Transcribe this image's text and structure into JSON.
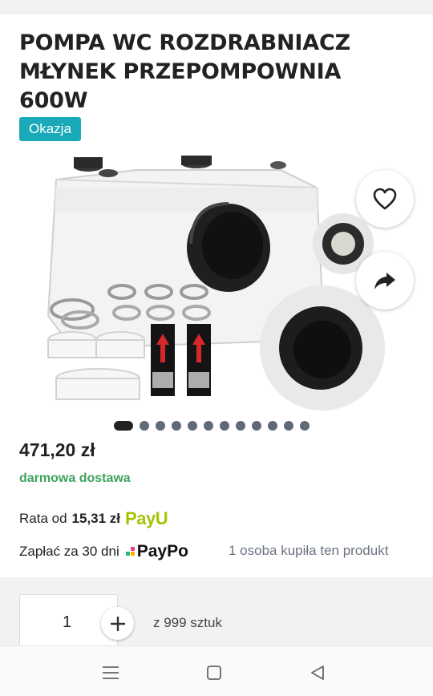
{
  "product": {
    "title_line1": "POMPA WC ROZDRABNIACZ",
    "title_line2": "MŁYNEK PRZEPOMPOWNIA",
    "title_line3": "600W",
    "badge": "Okazja"
  },
  "gallery": {
    "image_subject": "white macerator pump with accessories",
    "total_images": 12,
    "current_image": 1,
    "favorite_icon": "heart-icon",
    "share_icon": "share-arrow-icon"
  },
  "pricing": {
    "price": "471,20 zł",
    "delivery": "darmowa dostawa",
    "installment_prefix": "Rata od",
    "installment_amount": "15,31 zł",
    "installment_provider": "PayU",
    "deferred_label": "Zapłać za 30 dni",
    "deferred_provider": "PayPo",
    "sold_info": "1 osoba kupiła ten produkt"
  },
  "quantity": {
    "value": "1",
    "stock_text": "z 999 sztuk"
  },
  "system_nav": {
    "menu_icon": "menu-icon",
    "home_icon": "square-home-icon",
    "back_icon": "triangle-back-icon"
  },
  "colors": {
    "badge": "#1aa9b8",
    "delivery": "#3fa35e",
    "payu": "#a6c307"
  }
}
